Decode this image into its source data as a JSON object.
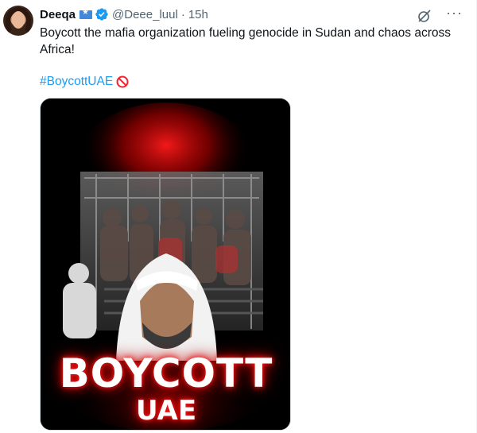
{
  "tweet": {
    "display_name": "Deeqa",
    "handle": "@Deee_luul",
    "separator": "·",
    "time": "15h",
    "text": "Boycott the mafia organization fueling genocide in Sudan and chaos across Africa!",
    "hashtag": "#BoycottUAE"
  },
  "media": {
    "line1": "BOYCOTT",
    "line2": "UAE"
  },
  "icons": {
    "flag": "somalia-flag-icon",
    "verified": "verified-badge-icon",
    "grok": "grok-icon",
    "more": "more-options-icon",
    "no_entry": "no-entry-emoji-icon"
  },
  "colors": {
    "link": "#1d9bf0",
    "secondary_text": "#536471",
    "glow": "#e00000"
  }
}
